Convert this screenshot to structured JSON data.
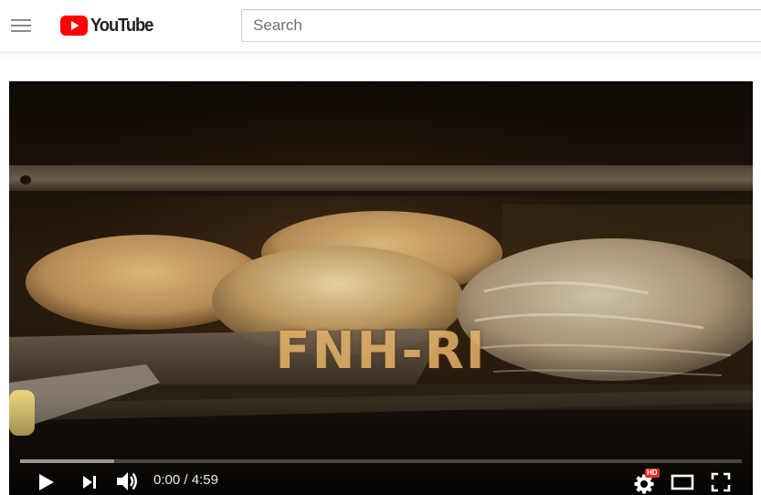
{
  "header": {
    "menu_icon": "hamburger-menu-icon",
    "logo_text": "YouTube",
    "brand_color": "#ff0000",
    "search": {
      "placeholder": "Search",
      "value": ""
    }
  },
  "player": {
    "overlay_title": "FNH-RI",
    "time": {
      "current": "0:00",
      "separator": " / ",
      "duration": "4:59"
    },
    "progress": {
      "played": 0,
      "loaded": 0.13
    },
    "quality_badge": "HD",
    "icons": {
      "play": "play-icon",
      "next": "next-icon",
      "volume": "volume-icon",
      "settings": "settings-gear-icon",
      "theater": "theater-mode-icon",
      "fullscreen": "fullscreen-icon"
    },
    "colors": {
      "progress_played": "#ff0000",
      "hd_badge": "#e52d27"
    }
  }
}
